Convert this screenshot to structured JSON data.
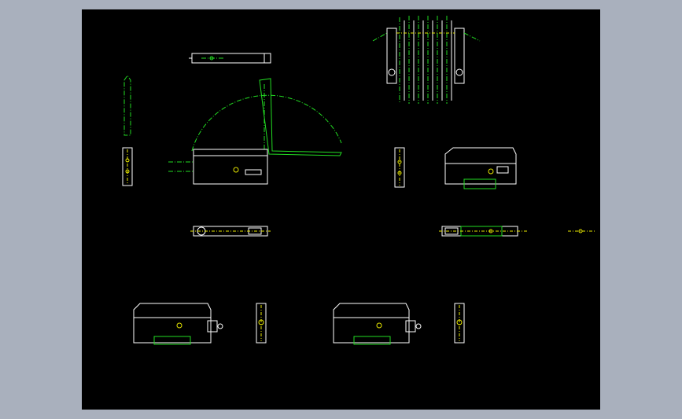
{
  "viewport": {
    "background": "#000000",
    "workspace_background": "#a9b0bd",
    "line_colors": {
      "outline": "#ffffff",
      "hidden_dashed": "#22dd22",
      "centerline": "#e6e600"
    }
  },
  "ucs_labels": [
    "",
    ""
  ],
  "views": [
    "top-view-sensor-body",
    "side-view-with-hinge-arc",
    "end-view-left",
    "front-view-upper-left",
    "stacked-array-view",
    "end-view-middle",
    "front-view-upper-right",
    "bottom-view-left",
    "bottom-view-right",
    "center-mark",
    "front-view-lower-left",
    "end-view-lower-left",
    "front-view-lower-middle",
    "end-view-lower-middle"
  ]
}
